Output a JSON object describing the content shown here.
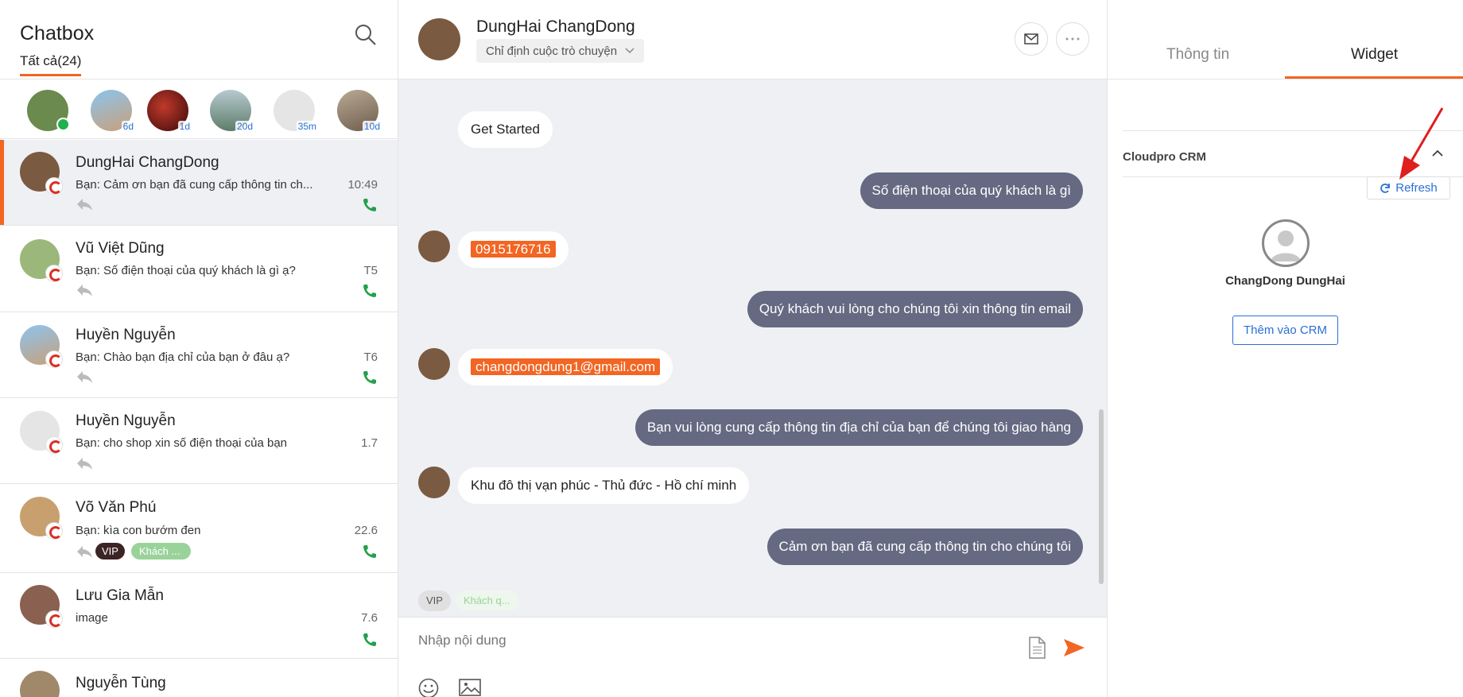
{
  "left": {
    "title": "Chatbox",
    "tab_all": "Tất cả(24)",
    "search_icon": "search-icon",
    "strip": [
      {
        "badge": "",
        "online": true,
        "color": "#6b8a4e"
      },
      {
        "badge": "6d",
        "color": "#7fb3d8"
      },
      {
        "badge": "1d",
        "color": "#8b1a1a"
      },
      {
        "badge": "20d",
        "color": "#8fa6a0"
      },
      {
        "badge": "35m",
        "color": "#e5e5e5"
      },
      {
        "badge": "10d",
        "color": "#9a8a78"
      }
    ],
    "conversations": [
      {
        "name": "DungHai ChangDong",
        "message": "Bạn: Cảm ơn bạn đã cung cấp thông tin ch...",
        "time": "10:49",
        "phone": true,
        "color": "#7a5a40"
      },
      {
        "name": "Vũ Việt Dũng",
        "message": "Bạn: Số điện thoại của quý khách là gì ạ?",
        "time": "T5",
        "phone": true,
        "color": "#9bb87a"
      },
      {
        "name": "Huyền Nguyễn",
        "message": "Bạn: Chào bạn địa chỉ của bạn ở đâu ạ?",
        "time": "T6",
        "phone": true,
        "color": "#7fb3d8"
      },
      {
        "name": "Huyền Nguyễn",
        "message": "Bạn: cho shop xin số điện thoại của bạn",
        "time": "1.7",
        "phone": false,
        "color": "#e5e5e5"
      },
      {
        "name": "Võ Văn Phú",
        "message": "Bạn: kìa con bướm đen",
        "time": "22.6",
        "phone": true,
        "color": "#c8a070",
        "tags": [
          "VIP",
          "Khách ..."
        ]
      },
      {
        "name": "Lưu Gia Mẫn",
        "message": " image",
        "time": "7.6",
        "phone": true,
        "color": "#8a6050"
      },
      {
        "name": "Nguyễn Tùng",
        "message": "",
        "time": "",
        "phone": false,
        "color": "#a0886a"
      }
    ]
  },
  "chat": {
    "contact_name": "DungHai ChangDong",
    "assign_label": "Chỉ định cuộc trò chuyện",
    "messages": [
      {
        "dir": "in",
        "text": "Get Started",
        "avatar": false
      },
      {
        "dir": "out",
        "text": "Số điện thoại của quý khách là gì"
      },
      {
        "dir": "in",
        "text": "0915176716",
        "avatar": true,
        "highlight": true
      },
      {
        "dir": "out",
        "text": "Quý khách vui lòng cho chúng tôi xin thông tin email"
      },
      {
        "dir": "in",
        "text": "changdongdung1@gmail.com",
        "avatar": true,
        "highlight": true
      },
      {
        "dir": "out",
        "text": "Bạn vui lòng cung cấp thông tin địa chỉ của bạn để chúng tôi giao hàng"
      },
      {
        "dir": "in",
        "text": "Khu đô thị vạn phúc - Thủ đức - Hồ chí minh",
        "avatar": true
      },
      {
        "dir": "out",
        "text": "Cảm ơn bạn đã cung cấp thông tin cho chúng tôi"
      }
    ],
    "tags": [
      "VIP",
      "Khách q..."
    ],
    "input_placeholder": "Nhập nội dung"
  },
  "right": {
    "tabs": [
      "Thông tin",
      "Widget"
    ],
    "active_tab": "Widget",
    "crm_title": "Cloudpro CRM",
    "refresh_label": "Refresh",
    "contact_name": "ChangDong DungHai",
    "add_button": "Thêm vào CRM"
  },
  "colors": {
    "accent": "#f26522",
    "outgoing_bubble": "#656a82",
    "link_blue": "#2a6fd6",
    "phone_green": "#22a04c"
  }
}
